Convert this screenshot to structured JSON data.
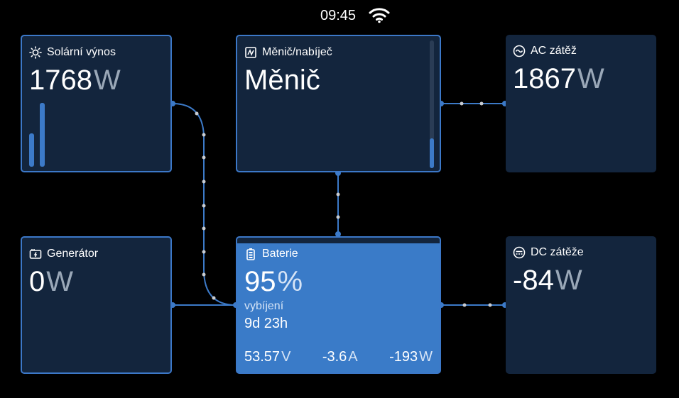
{
  "status": {
    "time": "09:45",
    "wifi_icon": "wifi-icon"
  },
  "solar": {
    "title": "Solární výnos",
    "value": "1768",
    "unit": "W",
    "icon": "sun-icon",
    "bar_levels": [
      0.3,
      0.6
    ]
  },
  "inverter": {
    "title": "Měnič/nabíječ",
    "mode": "Měnič",
    "icon": "inverter-icon"
  },
  "ac_load": {
    "title": "AC zátěž",
    "value": "1867",
    "unit": "W",
    "icon": "ac-icon"
  },
  "generator": {
    "title": "Generátor",
    "value": "0",
    "unit": "W",
    "icon": "generator-icon"
  },
  "battery": {
    "title": "Baterie",
    "soc": "95",
    "soc_unit": "%",
    "state": "vybíjení",
    "time_to_go": "9d 23h",
    "voltage": "53.57",
    "voltage_unit": "V",
    "current": "-3.6",
    "current_unit": "A",
    "power": "-193",
    "power_unit": "W",
    "icon": "battery-icon"
  },
  "dc_loads": {
    "title": "DC zátěže",
    "value": "-84",
    "unit": "W",
    "icon": "dc-icon"
  },
  "colors": {
    "accent": "#3c7ac8",
    "tile": "#13253d",
    "battery_fill": "#3a7bc8"
  }
}
